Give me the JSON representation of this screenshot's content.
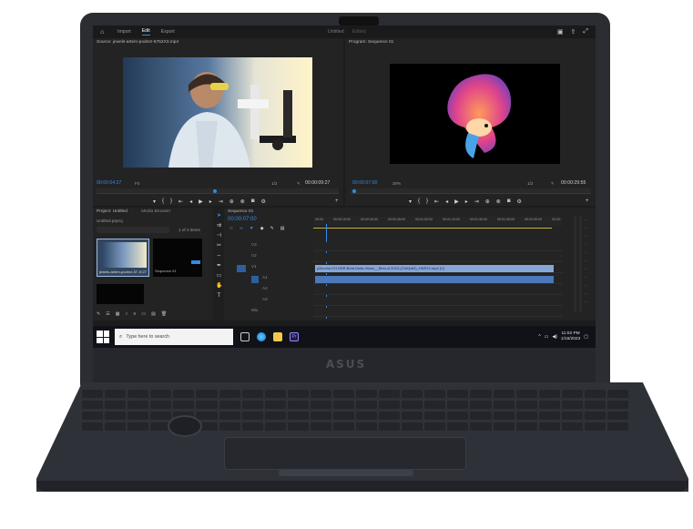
{
  "brand": "ASUS",
  "app": {
    "workspace_tabs": [
      "Import",
      "Edit",
      "Export"
    ],
    "active_tab": "Edit",
    "document_title": "Untitled",
    "document_status": "Edited"
  },
  "source_monitor": {
    "title": "Source: jewels-artem-podrez-5752X3.mp4",
    "timecode_in": "00:00:04:27",
    "fit": "Fit",
    "zoom": "1/2",
    "timecode_duration": "00:00:09:27"
  },
  "program_monitor": {
    "title": "Program: Sequence 01",
    "timecode_in": "00:00:07:00",
    "zoom": "20%",
    "resolution": "1/2",
    "timecode_duration": "00:00:29:55"
  },
  "project_panel": {
    "tabs": [
      "Project: Untitled",
      "Media Browser"
    ],
    "project_file": "Untitled.prproj",
    "item_count": "1 of 3 items",
    "items": [
      {
        "label": "jewels-artem-podrez-57...",
        "duration": "9:27"
      },
      {
        "label": "Sequence 01",
        "duration": ""
      },
      {
        "label": "",
        "duration": ""
      }
    ]
  },
  "sequence": {
    "tab": "Sequence 01",
    "timecode": "00:00:07:00",
    "ruler_labels": [
      "00:00",
      "00:00:15:00",
      "00:00:30:00",
      "00:00:45:00",
      "00:01:00:00",
      "00:01:15:00",
      "00:01:30:00",
      "00:01:45:00",
      "00:02:00:00",
      "00:02:"
    ],
    "tracks": [
      "V3",
      "V2",
      "V1",
      "A1",
      "A2",
      "A3",
      "Mix"
    ],
    "clip_label": "y2bcolor.CH.HDR.Beta.Delta.Vision__Best.of.2023.(2160p60)_HDR10.mp4 [V]"
  },
  "taskbar": {
    "search_placeholder": "Type here to search",
    "time": "11:02 PM",
    "date": "1/16/2023"
  }
}
